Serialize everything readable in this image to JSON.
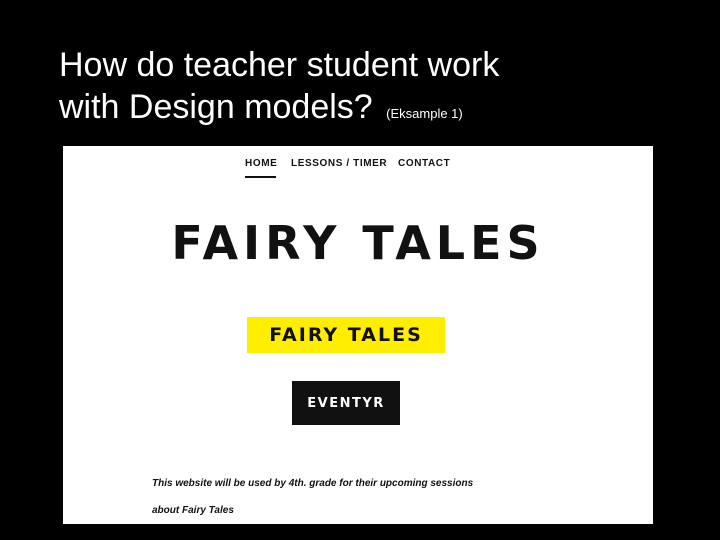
{
  "slide": {
    "title_line1": "How do teacher student work",
    "title_line2": "with Design models?",
    "title_note": "(Eksample 1)"
  },
  "website": {
    "nav": {
      "home": "HOME",
      "lessons": "LESSONS / TIMER",
      "contact": "CONTACT",
      "active": "HOME"
    },
    "hero_title": "FAIRY TALES",
    "yellow_label": "FAIRY TALES",
    "button_label": "EVENTYR",
    "description_line1": "This website will be used by 4th. grade for their upcoming sessions",
    "description_line2": "about Fairy Tales"
  },
  "colors": {
    "slide_background": "#000000",
    "slide_text": "#ffffff",
    "page_background": "#ffffff",
    "accent_yellow": "#ffee00",
    "dark": "#111111"
  }
}
